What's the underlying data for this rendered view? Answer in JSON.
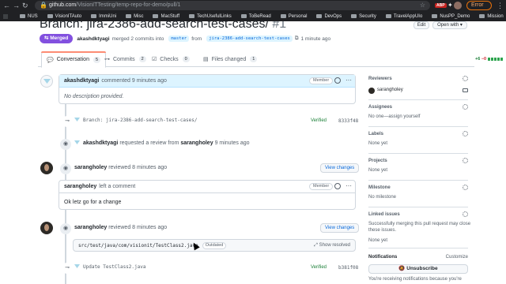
{
  "browser": {
    "url_host": "github.com",
    "url_path": "/VisionITTesting/temp-repo-for-demo/pull/1",
    "error_label": "Error",
    "ext_badge": "ABP",
    "bookmarks": [
      "NUS",
      "VisionITAuto",
      "ImmiUni",
      "Misc",
      "MacStuff",
      "TechUsefulLinks",
      "ToBeRead",
      "Personal",
      "DevOps",
      "Security",
      "TravelAppUIo",
      "NusPP_Demo",
      "Mission"
    ]
  },
  "header": {
    "title": "Branch: jira-2386-add-search-test-cases/",
    "number": "#1",
    "edit_label": "Edit",
    "open_with_label": "Open with ▾"
  },
  "state": {
    "badge": "Merged",
    "author": "akashdktyagi",
    "text": "merged 2 commits into",
    "base": "master",
    "from": "from",
    "head": "jira-2386-add-search-test-cases",
    "time": "1 minute ago"
  },
  "tabs": [
    {
      "label": "Conversation",
      "count": "5"
    },
    {
      "label": "Commits",
      "count": "2"
    },
    {
      "label": "Checks",
      "count": "0"
    },
    {
      "label": "Files changed",
      "count": "1"
    }
  ],
  "diffstat": {
    "add": "+6",
    "del": "−0"
  },
  "timeline": {
    "c1_author": "akashdktyagi",
    "c1_action": "commented 9 minutes ago",
    "c1_role": "Member",
    "c1_body": "No description provided.",
    "commit1_msg": "Branch: jira-2386-add-search-test-cases/",
    "commit1_verified": "Verified",
    "commit1_sha": "8333f48",
    "req_author": "akashdktyagi",
    "req_text": "requested a review from",
    "req_target": "sarangholey",
    "req_time": "9 minutes ago",
    "rev1_author": "sarangholey",
    "rev1_text": "reviewed 8 minutes ago",
    "view_changes": "View changes",
    "c2_author": "sarangholey",
    "c2_action": "left a comment",
    "c2_role": "Member",
    "c2_body": "Ok letz go for a change",
    "rev2_author": "sarangholey",
    "rev2_text": "reviewed 8 minutes ago",
    "file_path": "src/test/java/com/visionit/TestClass2.java",
    "outdated": "Outdated",
    "show_resolved": "Show resolved",
    "commit2_msg": "Update TestClass2.java",
    "commit2_verified": "Verified",
    "commit2_sha": "b381f08"
  },
  "sidebar": {
    "reviewers_title": "Reviewers",
    "reviewer": "sarangholey",
    "assignees_title": "Assignees",
    "assignees_text": "No one—assign yourself",
    "labels_title": "Labels",
    "labels_text": "None yet",
    "projects_title": "Projects",
    "projects_text": "None yet",
    "milestone_title": "Milestone",
    "milestone_text": "No milestone",
    "linked_title": "Linked issues",
    "linked_text1": "Successfully merging this pull request may close",
    "linked_text2": "these issues.",
    "linked_none": "None yet",
    "notif_title": "Notifications",
    "customize": "Customize",
    "unsubscribe": "🔕 Unsubscribe",
    "notif_text": "You're receiving notifications because you're"
  }
}
